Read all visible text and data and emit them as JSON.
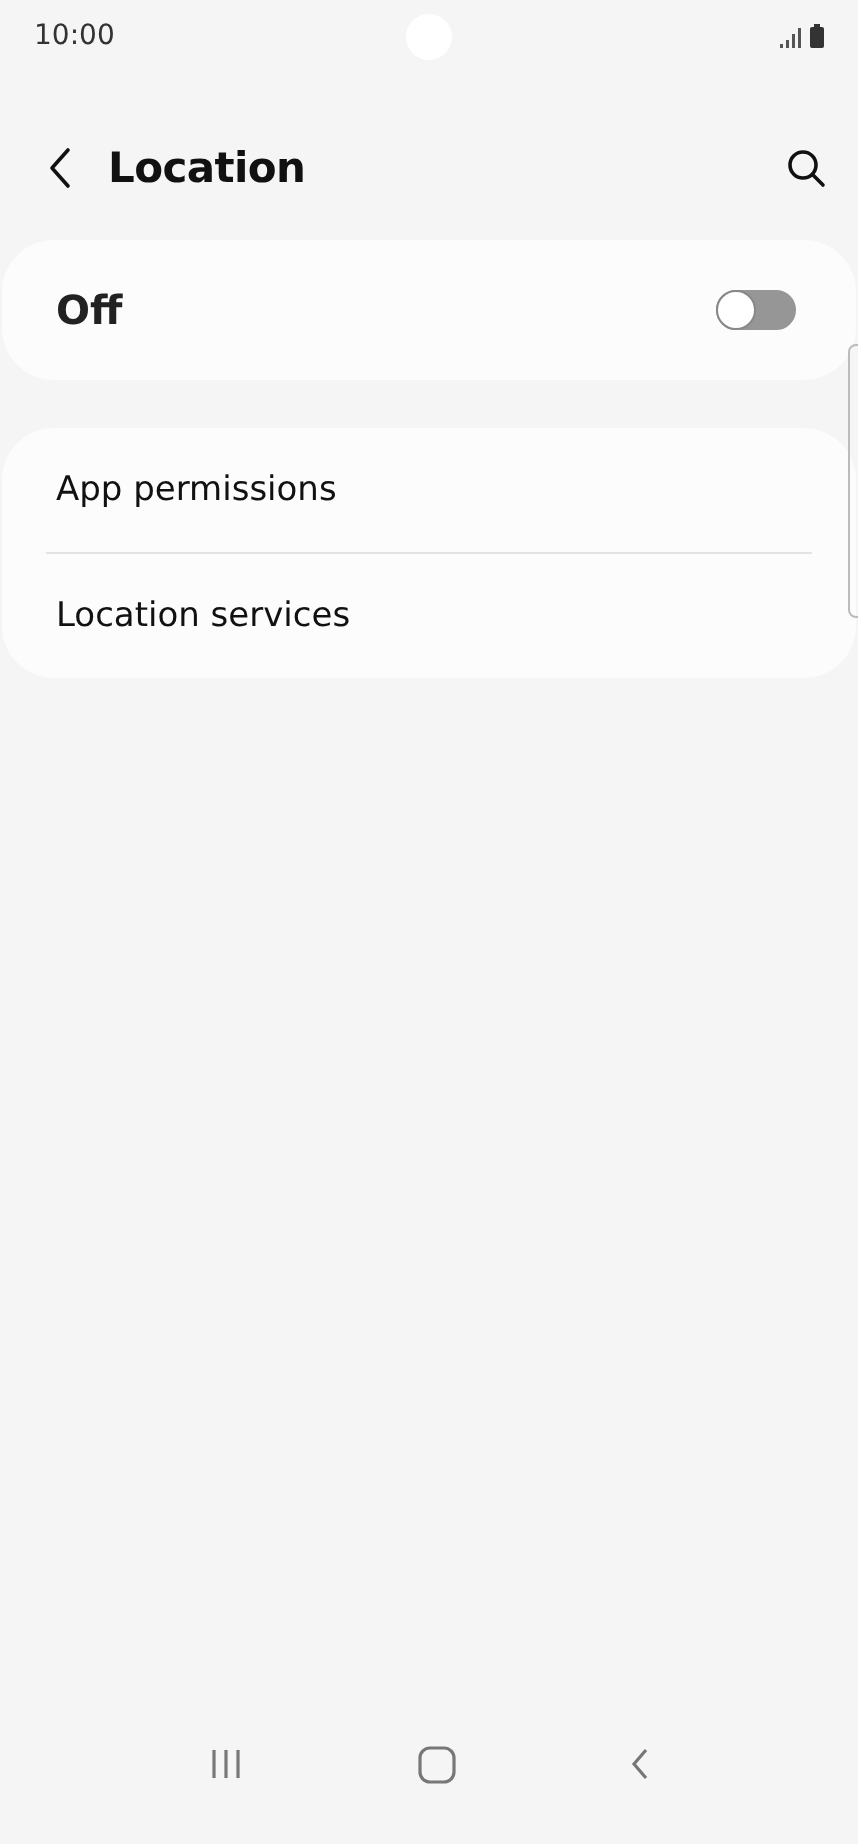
{
  "status_bar": {
    "time": "10:00"
  },
  "header": {
    "title": "Location"
  },
  "master_switch": {
    "label": "Off",
    "on": false
  },
  "items": [
    {
      "label": "App permissions"
    },
    {
      "label": "Location services"
    }
  ]
}
